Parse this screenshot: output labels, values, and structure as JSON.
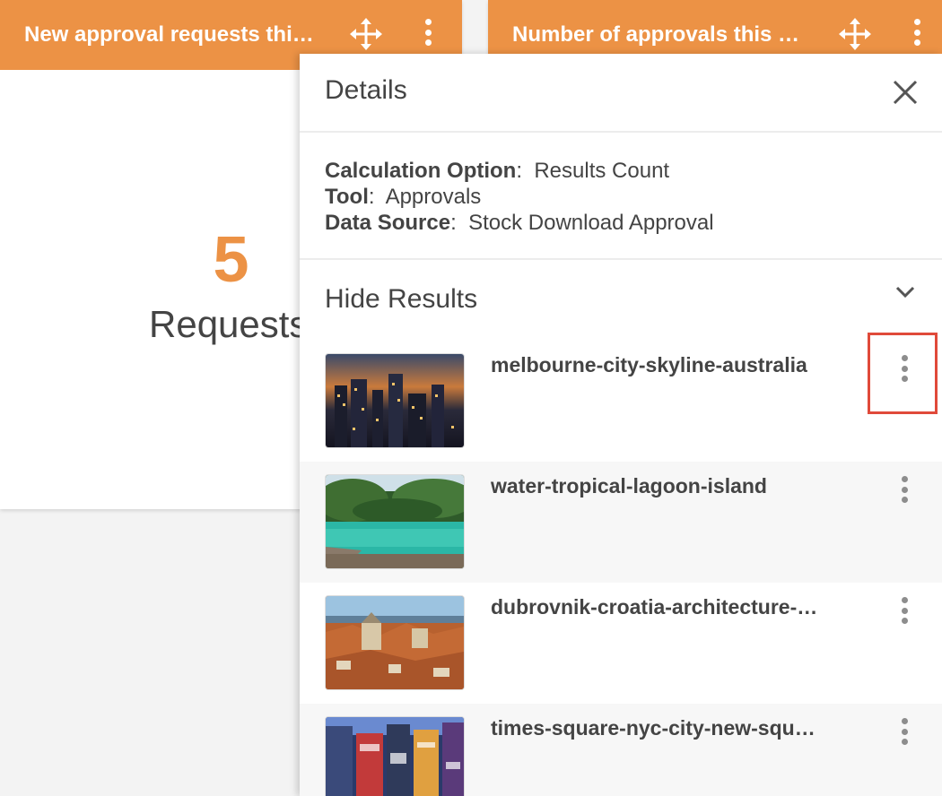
{
  "widgets": [
    {
      "title": "New approval requests thi…",
      "value": "5",
      "value_label": "Requests"
    },
    {
      "title": "Number of approvals this …"
    }
  ],
  "details": {
    "title": "Details",
    "info": [
      {
        "key": "Calculation Option",
        "value": "Results Count"
      },
      {
        "key": "Tool",
        "value": "Approvals"
      },
      {
        "key": "Data Source",
        "value": "Stock Download Approval"
      }
    ],
    "results_toggle_label": "Hide Results",
    "results": [
      {
        "name": "melbourne-city-skyline-australia",
        "thumbnail": "city-night-skyline"
      },
      {
        "name": "water-tropical-lagoon-island",
        "thumbnail": "tropical-lagoon"
      },
      {
        "name": "dubrovnik-croatia-architecture-…",
        "thumbnail": "old-town-rooftops"
      },
      {
        "name": "times-square-nyc-city-new-squ…",
        "thumbnail": "times-square"
      }
    ]
  },
  "colors": {
    "accent": "#ec9245",
    "highlight": "#e04a3a"
  }
}
